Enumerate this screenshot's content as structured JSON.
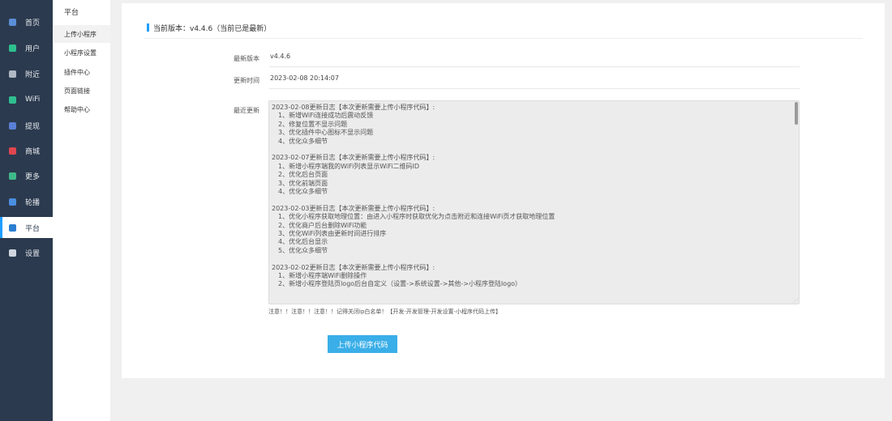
{
  "nav": {
    "items": [
      {
        "label": "首页",
        "icon": "home-icon",
        "color": "#5a8fd6"
      },
      {
        "label": "用户",
        "icon": "user-icon",
        "color": "#2fbf8f"
      },
      {
        "label": "附近",
        "icon": "location-icon",
        "color": "#b0b8c4"
      },
      {
        "label": "WiFi",
        "icon": "wifi-icon",
        "color": "#2fbf8f"
      },
      {
        "label": "提现",
        "icon": "withdraw-icon",
        "color": "#5a7fd6"
      },
      {
        "label": "商城",
        "icon": "shop-icon",
        "color": "#e0454f"
      },
      {
        "label": "更多",
        "icon": "more-icon",
        "color": "#3fb98a"
      },
      {
        "label": "轮播",
        "icon": "carousel-icon",
        "color": "#4a8ee0"
      },
      {
        "label": "平台",
        "icon": "platform-icon",
        "color": "#2b7fd0",
        "active": true
      },
      {
        "label": "设置",
        "icon": "gear-icon",
        "color": "#cfd6df"
      }
    ]
  },
  "subnav": {
    "title": "平台",
    "items": [
      {
        "label": "上传小程序",
        "active": true
      },
      {
        "label": "小程序设置"
      },
      {
        "label": "插件中心"
      },
      {
        "label": "页面链接"
      },
      {
        "label": "帮助中心"
      }
    ]
  },
  "main": {
    "header": "当前版本：v4.4.6（当前已是最新）",
    "latest_version_label": "最新版本",
    "latest_version_value": "v4.4.6",
    "update_time_label": "更新时间",
    "update_time_value": "2023-02-08 20:14:07",
    "recent_label": "最近更新",
    "log": [
      {
        "title": "2023-02-08更新日志【本次更新需要上传小程序代码】:",
        "items": [
          "1、新增WiFi连接成功后震动反馈",
          "2、修复位置不显示问题",
          "3、优化插件中心图标不显示问题",
          "4、优化众多细节"
        ]
      },
      {
        "title": "2023-02-07更新日志【本次更新需要上传小程序代码】:",
        "items": [
          "1、新增小程序端我的WiFi列表显示WiFi二维码ID",
          "2、优化后台页面",
          "3、优化前端页面",
          "4、优化众多细节"
        ]
      },
      {
        "title": "2023-02-03更新日志【本次更新需要上传小程序代码】:",
        "items": [
          "1、优化小程序获取地理位置：由进入小程序时获取优化为点击附近和连接WiFi页才获取地理位置",
          "2、优化商户后台删除WiFi功能",
          "3、优化WiFi列表由更新时间进行排序",
          "4、优化后台显示",
          "5、优化众多细节"
        ]
      },
      {
        "title": "2023-02-02更新日志【本次更新需要上传小程序代码】:",
        "items": [
          "1、新增小程序端WiFi删除操作",
          "2、新增小程序登陆页logo后台自定义（设置->系统设置->其他->小程序登陆logo）"
        ]
      }
    ],
    "notice": "注意！！注意！！注意！！记得关闭ip白名单！【开发-开发管理-开发设置-小程序代码上传】",
    "upload_button": "上传小程序代码"
  }
}
